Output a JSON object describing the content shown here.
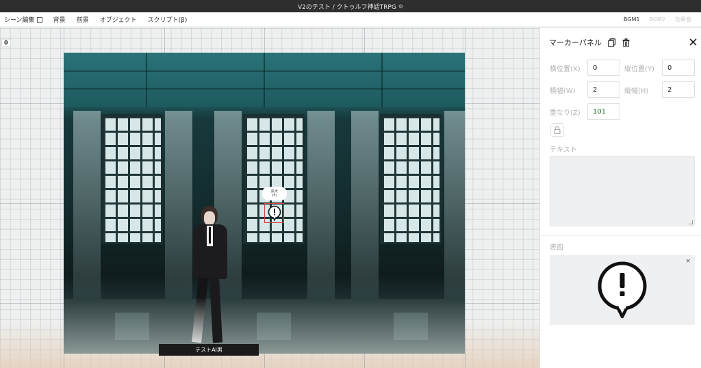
{
  "window": {
    "title": "V2のテスト / クトゥルフ神話TRPG",
    "settings_icon": "gear-icon"
  },
  "menu": {
    "scene_edit": "シーン編集",
    "background": "背景",
    "foreground": "前景",
    "object": "オブジェクト",
    "script": "スクリプト(β)",
    "bgm1": "BGM1",
    "bgm2": "BGM2",
    "sound_effect": "効果音"
  },
  "canvas": {
    "zoom_label": "0",
    "character_name": "テストAI男",
    "marker_tooltip_line1": "拡大",
    "marker_tooltip_line2": "(E)",
    "marker_icon": "exclamation-bubble-icon"
  },
  "panel": {
    "title": "マーカーパネル",
    "copy_icon": "copy-icon",
    "delete_icon": "trash-icon",
    "close_icon": "close-icon",
    "x_label": "横位置(X)",
    "x_value": "0",
    "y_label": "縦位置(Y)",
    "y_value": "0",
    "w_label": "横幅(W)",
    "w_value": "2",
    "h_label": "縦幅(H)",
    "h_value": "2",
    "z_label": "重なり(Z)",
    "z_value": "101",
    "lock_icon": "lock-icon",
    "text_label": "テキスト",
    "text_value": "",
    "face_label": "表面",
    "face_remove": "×",
    "face_icon": "exclamation-bubble-icon"
  },
  "colors": {
    "titlebar": "#2e2e2e",
    "marker_border": "#d04444",
    "z_value_color": "#2a6e2a"
  }
}
